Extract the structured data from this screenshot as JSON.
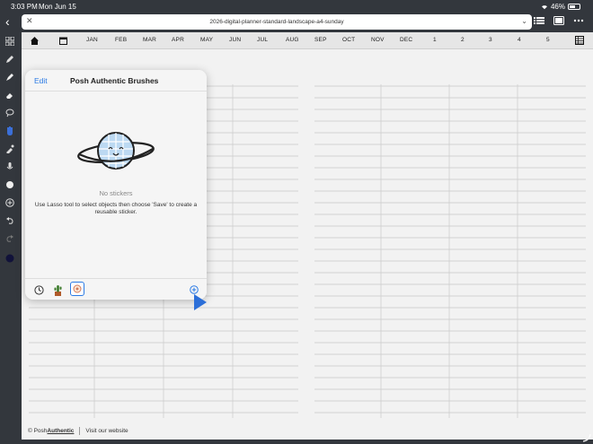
{
  "status": {
    "time": "3:03 PM",
    "date": "Mon Jun 15",
    "battery": "46%",
    "battery_level": 0.46
  },
  "document": {
    "title": "2026-digital-planner-standard-landscape-a4-sunday"
  },
  "tabs": [
    "JAN",
    "FEB",
    "MAR",
    "APR",
    "MAY",
    "JUN",
    "JUL",
    "AUG",
    "SEP",
    "OCT",
    "NOV",
    "DEC",
    "1",
    "2",
    "3",
    "4",
    "5"
  ],
  "stickers_panel": {
    "edit_label": "Edit",
    "title": "Posh Authentic Brushes",
    "empty_title": "No stickers",
    "empty_desc": "Use Lasso tool to select objects then choose 'Save' to create a reusable sticker."
  },
  "footer": {
    "copyright": "© Posh",
    "brand": "Authentic",
    "link": "Visit our website"
  },
  "colors": {
    "accent": "#2c7be5",
    "toolbar_bg": "#33373d",
    "page_bg": "#f2f2f2"
  },
  "icons": [
    "home-icon",
    "calendar-icon",
    "pen-icon",
    "highlighter-icon",
    "eraser-icon",
    "lasso-icon",
    "hand-icon",
    "eyedropper-icon",
    "microphone-icon",
    "sticker-icon",
    "add-icon",
    "undo-icon",
    "redo-icon",
    "color-swatch-icon"
  ]
}
